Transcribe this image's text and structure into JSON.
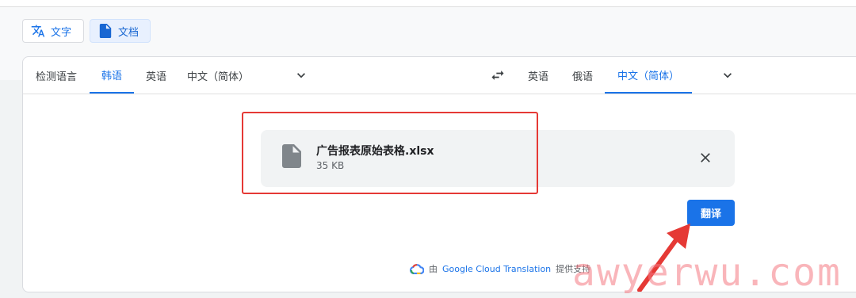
{
  "modes": {
    "text_label": "文字",
    "docs_label": "文档",
    "active": "docs"
  },
  "source_languages": {
    "tabs": [
      "检测语言",
      "韩语",
      "英语",
      "中文（简体）"
    ],
    "active_index": 1
  },
  "target_languages": {
    "tabs": [
      "英语",
      "俄语",
      "中文（简体）"
    ],
    "active_index": 2
  },
  "file": {
    "name": "广告报表原始表格.xlsx",
    "size": "35 KB"
  },
  "translate_button": "翻译",
  "footer": {
    "prefix": "由",
    "link": "Google Cloud Translation",
    "suffix": "提供支持"
  },
  "watermark": "awyerwu.com",
  "colors": {
    "accent": "#1a73e8",
    "annotation": "#e53935"
  },
  "icons": [
    "translate-icon",
    "document-icon",
    "chevron-down-icon",
    "swap-arrows-icon",
    "file-icon",
    "close-icon",
    "google-cloud-icon"
  ]
}
